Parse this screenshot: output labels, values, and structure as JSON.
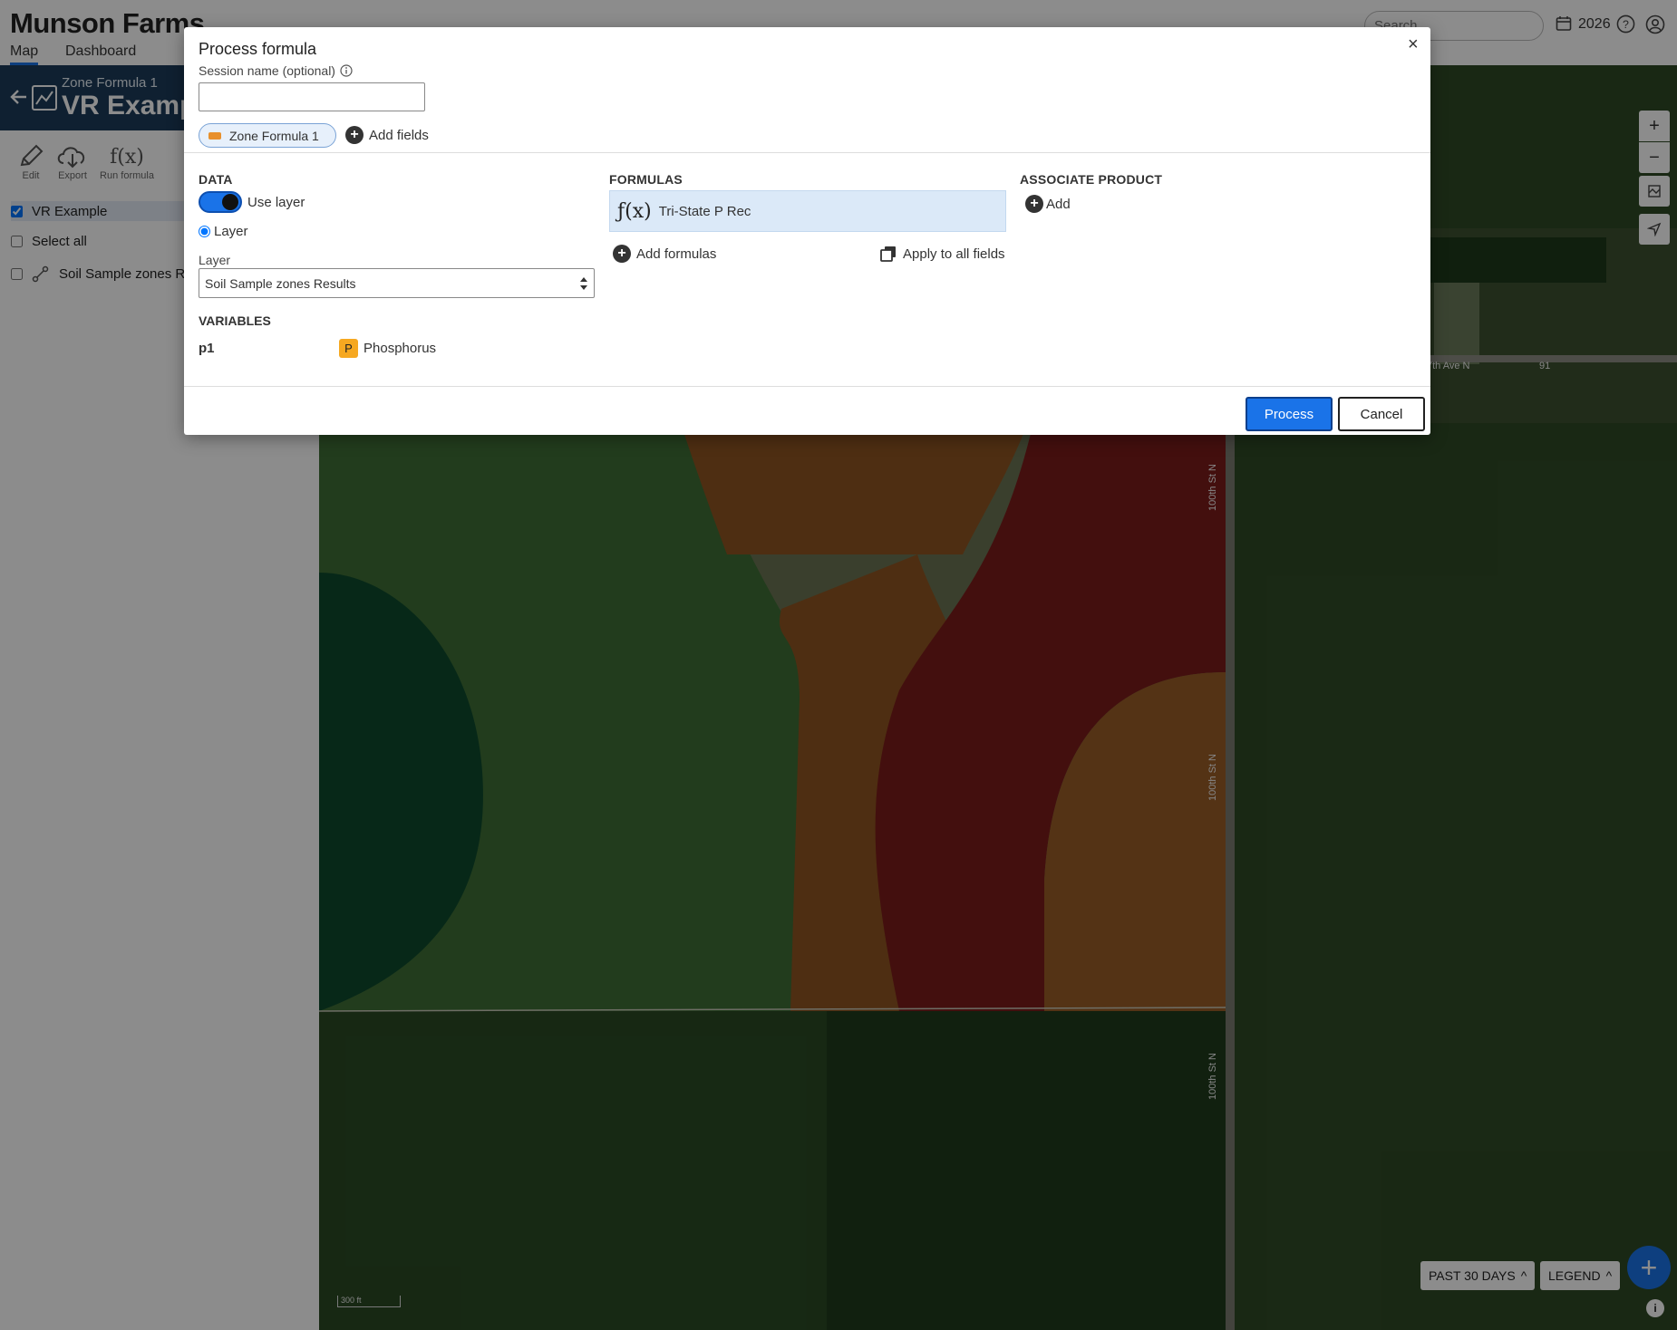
{
  "app": {
    "brand": "Munson Farms",
    "tabs": [
      {
        "label": "Map",
        "active": true
      },
      {
        "label": "Dashboard",
        "active": false
      }
    ],
    "search_placeholder": "Search",
    "year": "2026",
    "icons": [
      "calendar-icon",
      "help-icon",
      "user-icon"
    ],
    "accent_color": "#1a73e8"
  },
  "left_panel": {
    "subtitle": "Zone Formula 1",
    "title": "VR Example",
    "tools": [
      {
        "label": "Edit",
        "icon": "pencil-icon"
      },
      {
        "label": "Export",
        "icon": "cloud-download-icon"
      },
      {
        "label": "Run formula",
        "icon": "function-icon"
      }
    ],
    "layers": [
      {
        "label": "VR Example",
        "checked": true
      },
      {
        "label": "Select all",
        "checked": false
      },
      {
        "label": "Soil Sample zones Re",
        "checked": false
      }
    ]
  },
  "map": {
    "road_labels": [
      "7th Ave N",
      "91",
      "100th St N",
      "100th St N",
      "100th St N"
    ],
    "scale_label": "300 ft",
    "past_days": "PAST 30 DAYS",
    "legend": "LEGEND",
    "zone_colors": [
      "#0d4a2c",
      "#3d6e34",
      "#5b7a4a",
      "#6e7452",
      "#8d5322",
      "#861d1b",
      "#9a5d27"
    ]
  },
  "modal": {
    "title": "Process formula",
    "session_label": "Session name (optional)",
    "session_value": "",
    "field_chip": "Zone Formula 1",
    "add_fields": "Add fields",
    "data_head": "DATA",
    "use_layer": "Use layer",
    "use_layer_on": true,
    "layer_radio": "Layer",
    "layer_label": "Layer",
    "layer_selected": "Soil Sample zones Results",
    "variables_head": "VARIABLES",
    "variables": [
      {
        "name": "p1",
        "badge": "P",
        "value": "Phosphorus"
      }
    ],
    "formulas_head": "FORMULAS",
    "formula_item": "Tri-State P Rec",
    "add_formulas": "Add formulas",
    "apply_all": "Apply to all fields",
    "assoc_head": "ASSOCIATE PRODUCT",
    "assoc_add": "Add",
    "process": "Process",
    "cancel": "Cancel",
    "close": "×"
  }
}
